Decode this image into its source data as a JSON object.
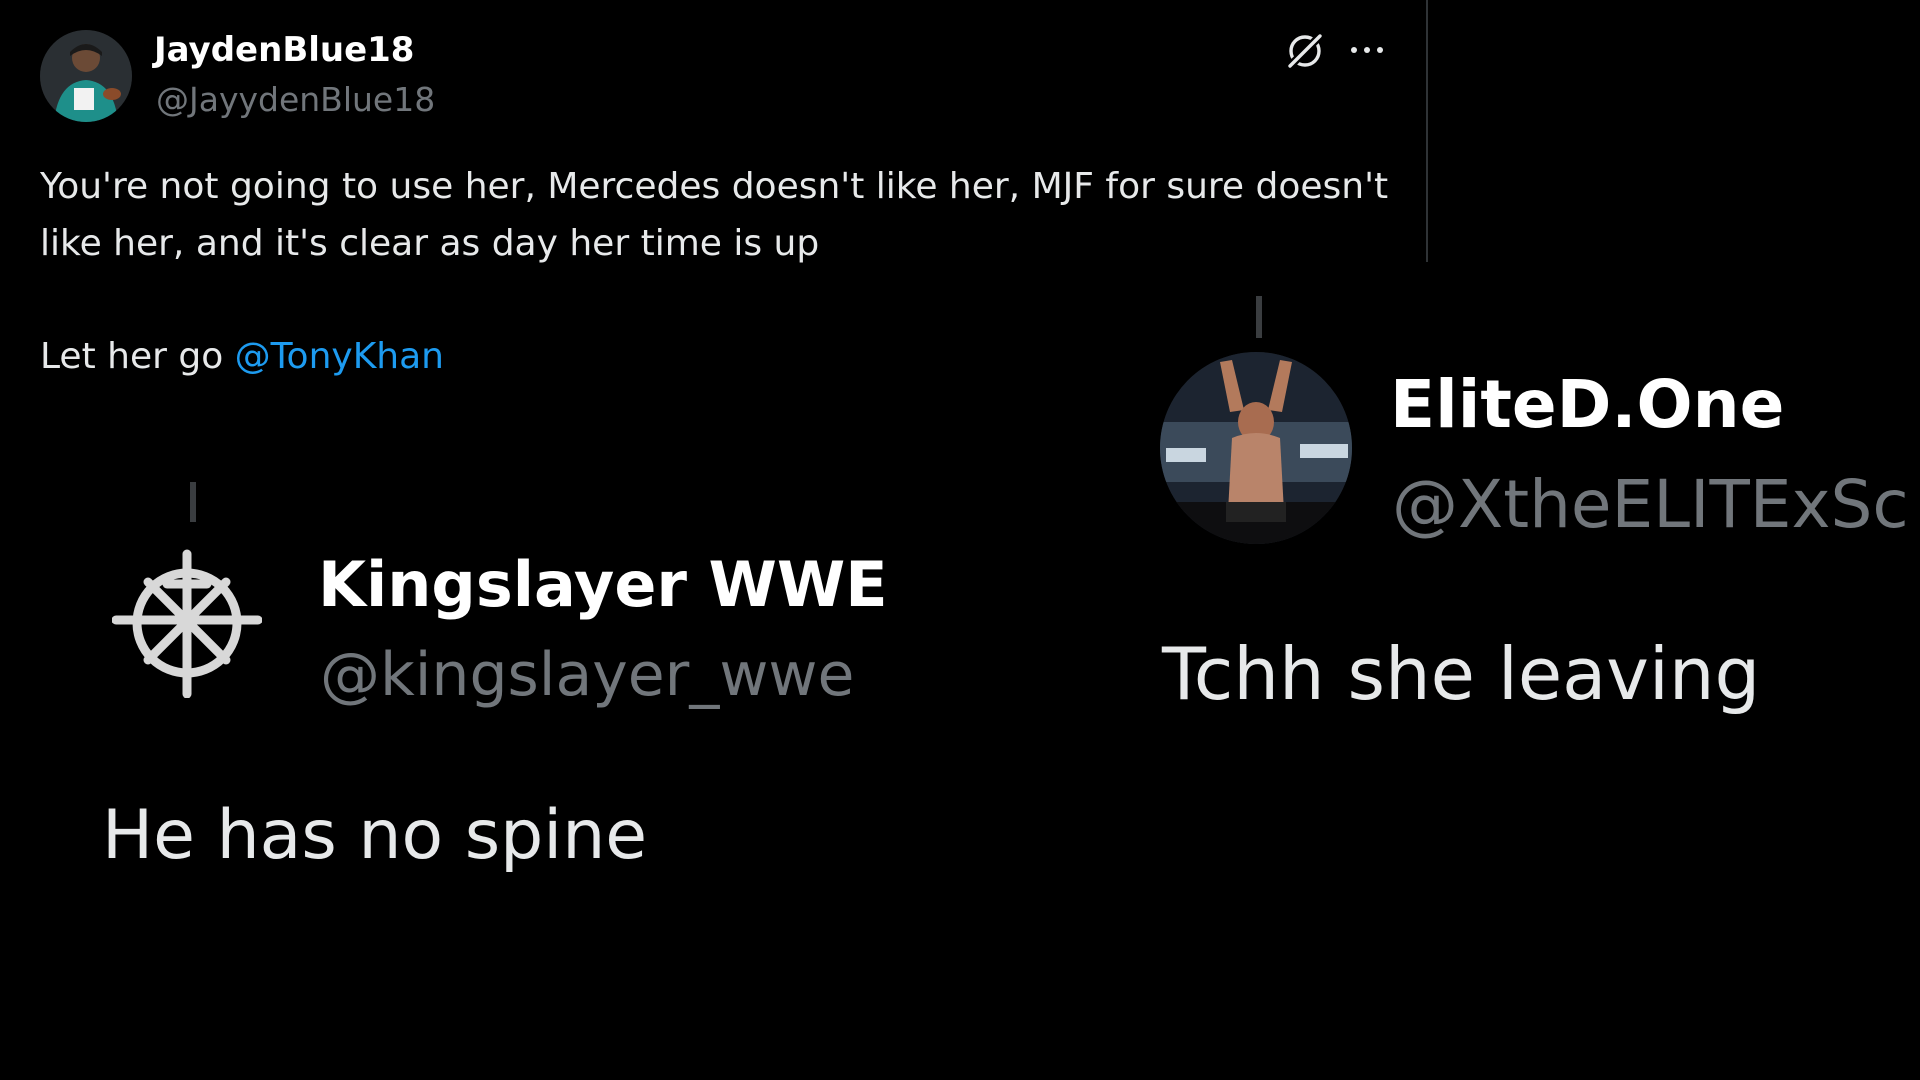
{
  "main_tweet": {
    "display_name": "JaydenBlue18",
    "handle": "@JayydenBlue18",
    "text_line_1": "You're not going to use her, Mercedes doesn't like her, MJF for sure doesn't",
    "text_line_2": "like her, and it's clear as day her time is up",
    "text_line_3_prefix": "Let her go ",
    "mention": "@TonyKhan",
    "actions": {
      "grok_icon": "grok-icon",
      "more_icon": "more-horizontal-icon"
    },
    "colors": {
      "mention": "#1d9bf0",
      "handle": "#71767b"
    }
  },
  "reply_left": {
    "display_name": "Kingslayer WWE",
    "handle": "@kingslayer_wwe",
    "text": "He has no spine",
    "avatar_icon": "seth-rollins-logo-icon"
  },
  "reply_right": {
    "display_name": "EliteD.One",
    "handle": "@XtheELITExSc",
    "text": "Tchh she leaving",
    "avatar_icon": "wrestler-photo-avatar"
  },
  "theme": {
    "background": "#000000",
    "text": "#e7e9ea"
  }
}
